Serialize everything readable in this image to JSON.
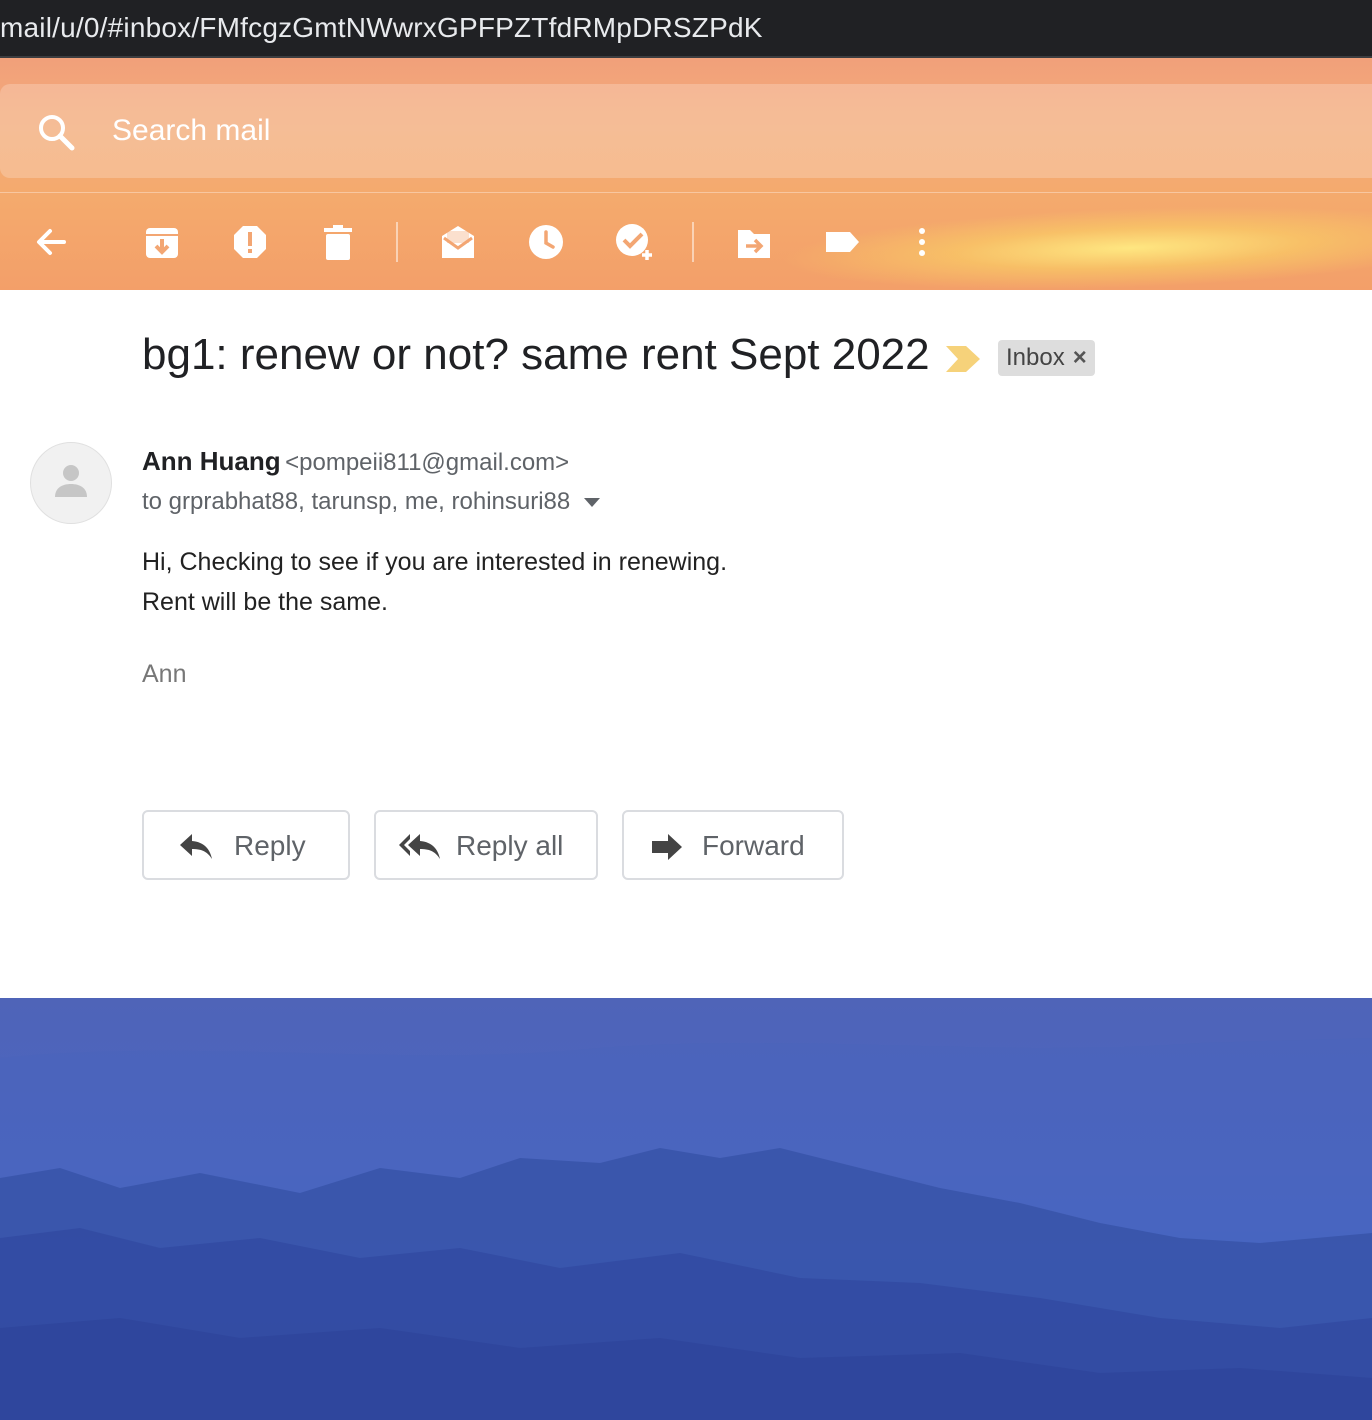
{
  "browser": {
    "url": "mail/u/0/#inbox/FMfcgzGmtNWwrxGPFPZTfdRMpDRSZPdK"
  },
  "search": {
    "placeholder": "Search mail"
  },
  "toolbar": {
    "icons": [
      "back-arrow-icon",
      "archive-icon",
      "report-spam-icon",
      "delete-icon",
      "mark-unread-icon",
      "snooze-icon",
      "add-to-tasks-icon",
      "move-to-icon",
      "labels-icon",
      "more-vert-icon"
    ]
  },
  "message": {
    "subject": "bg1: renew or not? same rent Sept 2022",
    "label": "Inbox",
    "label_remove": "×",
    "sender_name": "Ann Huang",
    "sender_email": "<pompeii811@gmail.com>",
    "recipients": "to grprabhat88, tarunsp, me, rohinsuri88",
    "body_line1": "Hi, Checking to see if you are interested in renewing.",
    "body_line2": "Rent will be the same.",
    "signature": "Ann"
  },
  "actions": {
    "reply": "Reply",
    "reply_all": "Reply all",
    "forward": "Forward"
  },
  "colors": {
    "header_orange": "#f3a673",
    "importance_yellow": "#f6d27a",
    "background_blue": "#4a66c2"
  }
}
